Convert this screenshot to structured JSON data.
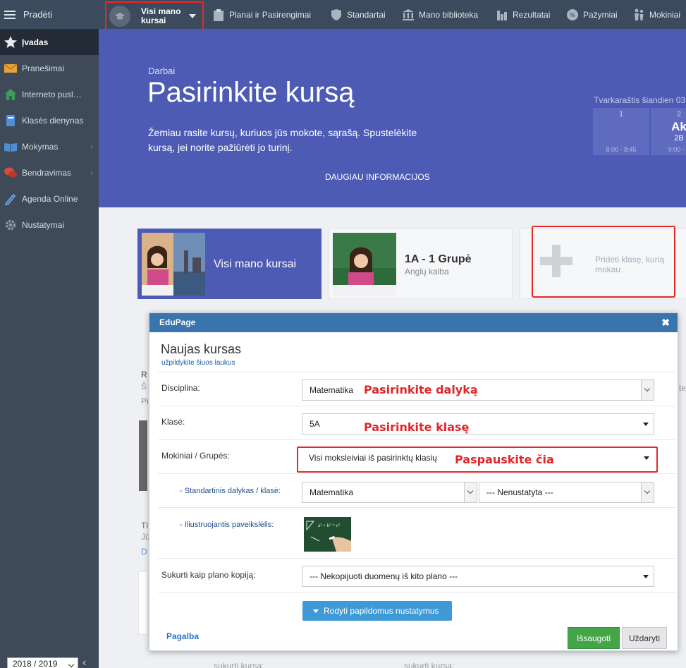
{
  "topbar": {
    "menu_label": "Pradėti",
    "courses_label": "Visi mano kursai",
    "nav": [
      {
        "label": "Planai ir Pasirengimai",
        "icon": "clipboard-icon"
      },
      {
        "label": "Standartai",
        "icon": "shield-icon"
      },
      {
        "label": "Mano biblioteka",
        "icon": "library-icon"
      },
      {
        "label": "Rezultatai",
        "icon": "bar-chart-icon"
      },
      {
        "label": "Pažymiai",
        "icon": "grades-icon"
      },
      {
        "label": "Mokiniai",
        "icon": "students-icon"
      }
    ]
  },
  "sidebar": {
    "items": [
      {
        "label": "Įvadas",
        "icon": "star-icon"
      },
      {
        "label": "Pranešimai",
        "icon": "envelope-icon"
      },
      {
        "label": "Interneto puslapis",
        "icon": "home-icon"
      },
      {
        "label": "Klasės dienynas",
        "icon": "book-icon"
      },
      {
        "label": "Mokymas",
        "icon": "open-book-icon"
      },
      {
        "label": "Bendravimas",
        "icon": "chat-icon"
      },
      {
        "label": "Agenda Online",
        "icon": "pencil-icon"
      },
      {
        "label": "Nustatymai",
        "icon": "gear-icon"
      }
    ],
    "year": "2018 / 2019"
  },
  "banner": {
    "crumb": "Darbai",
    "title": "Pasirinkite kursą",
    "description": "Žemiau rasite kursų, kuriuos jūs mokote, sąrašą. Spustelėkite kursą, jei norite pažiūrėti jo turinį.",
    "more_link": "DAUGIAU INFORMACIJOS",
    "schedule_title": "Tvarkaraštis šiandien 03",
    "schedule": [
      {
        "num": "1",
        "subject": "",
        "group": "",
        "time": "8:00 - 8:45"
      },
      {
        "num": "2",
        "subject": "Ak",
        "group": "2B",
        "time": "9:00 - 9"
      }
    ]
  },
  "cards": {
    "all_courses": "Visi mano kursai",
    "course_name": "1A - 1 Grupė",
    "course_subject": "Anglų kalba",
    "add_class": "Pridėti klasę, kurią mokau"
  },
  "background": {
    "frag1": "R",
    "frag2": "Š",
    "frag3": "Pi",
    "frag4": "Tl",
    "frag5": "Jū",
    "frag6": "D",
    "frag7": "te",
    "frag8": "sukurti kursą:",
    "frag9": "sukurti kursą:"
  },
  "modal": {
    "header": "EduPage",
    "title": "Naujas kursas",
    "subtitle": "užpildykite šiuos laukus",
    "discipline_label": "Disciplina:",
    "discipline_value": "Matematika",
    "class_label": "Klasė:",
    "class_value": "5A",
    "students_label": "Mokiniai / Grupės:",
    "students_value": "Visi moksleiviai iš pasirinktų klasių",
    "standard_label": "- Standartinis dalykas / klasė:",
    "standard_subject": "Matematika",
    "standard_class": "--- Nenustatyta ---",
    "image_label": "- Iliustruojantis paveikslėlis:",
    "copy_label": "Sukurti kaip plano kopiją:",
    "copy_value": "--- Nekopijuoti duomenų iš kito plano ---",
    "more_settings": "Rodyti papildomus nustatymus",
    "help": "Pagalba",
    "save": "Išsaugoti",
    "close": "Uždaryti"
  },
  "annotations": {
    "pick_subject": "Pasirinkite dalyką",
    "pick_class": "Pasirinkite klasę",
    "click_here": "Paspauskite čia"
  },
  "colors": {
    "topbar": "#3b4a5c",
    "sidebar": "#3e4a57",
    "banner": "#4e5bb5",
    "modal_header": "#3a74ad",
    "annotation": "#e0262a",
    "save_button": "#44a548"
  }
}
